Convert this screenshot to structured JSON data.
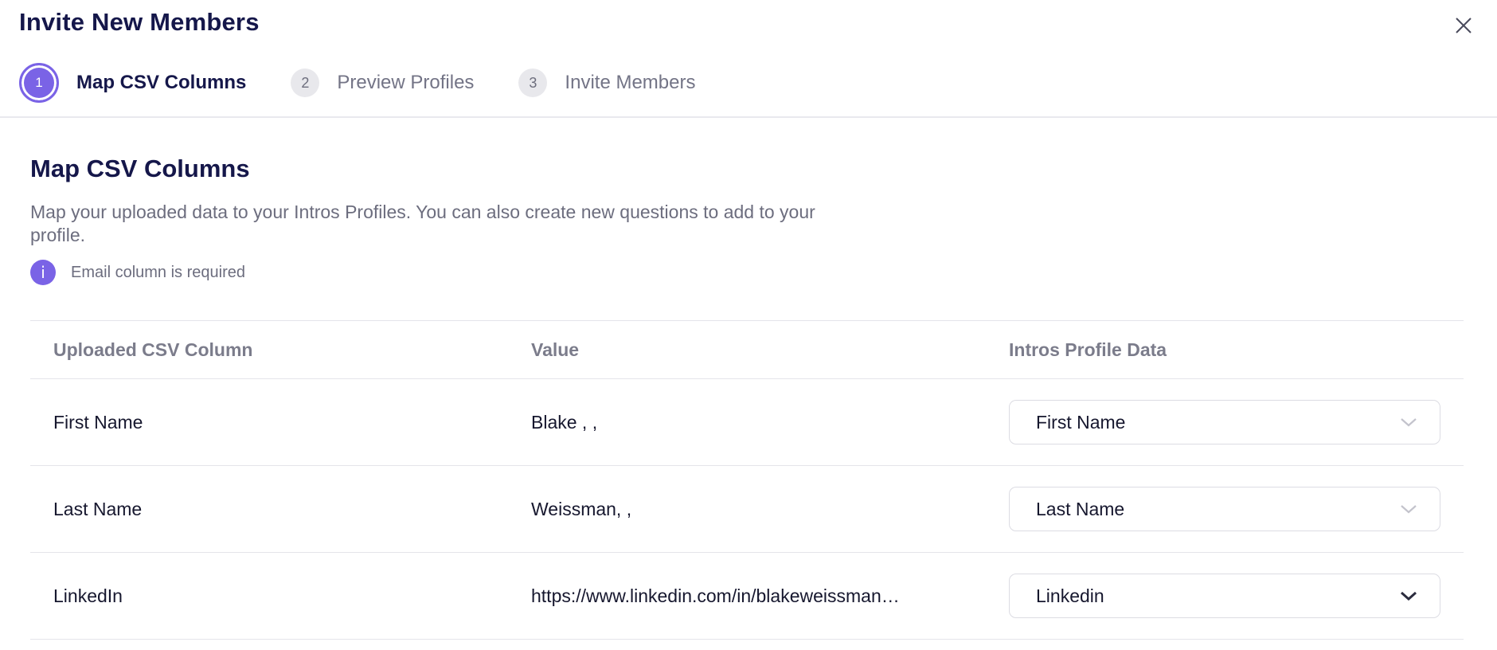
{
  "modal": {
    "title": "Invite New Members"
  },
  "steps": [
    {
      "number": "1",
      "label": "Map CSV Columns",
      "active": true
    },
    {
      "number": "2",
      "label": "Preview Profiles",
      "active": false
    },
    {
      "number": "3",
      "label": "Invite Members",
      "active": false
    }
  ],
  "section": {
    "title": "Map CSV Columns",
    "description": "Map your uploaded data to your Intros Profiles. You can also create new questions to add to your profile.",
    "info_icon": "i",
    "info_text": "Email column is required"
  },
  "table": {
    "headers": {
      "csv_column": "Uploaded CSV Column",
      "value": "Value",
      "profile_data": "Intros Profile Data"
    },
    "rows": [
      {
        "csv_column": "First Name",
        "value": "Blake , ,",
        "profile_field": "First Name"
      },
      {
        "csv_column": "Last Name",
        "value": "Weissman, ,",
        "profile_field": "Last Name"
      },
      {
        "csv_column": "LinkedIn",
        "value": "https://www.linkedin.com/in/blakeweissman…",
        "profile_field": "Linkedin"
      }
    ]
  },
  "colors": {
    "accent": "#7a63e6",
    "title_text": "#15174a",
    "muted_text": "#6c6d7e"
  },
  "icons": {
    "close": "close-icon",
    "info": "info-icon",
    "dropdown": "chevron-down-icon"
  }
}
